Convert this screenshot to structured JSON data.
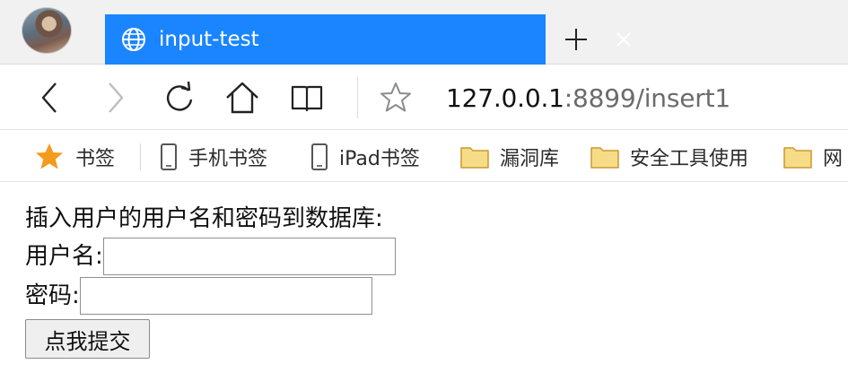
{
  "browser": {
    "tab": {
      "title": "input-test"
    },
    "address": {
      "host": "127.0.0.1",
      "path": ":8899/insert1"
    },
    "bookmarks": [
      {
        "icon": "star-icon",
        "label": "书签"
      },
      {
        "icon": "phone-icon",
        "label": "手机书签"
      },
      {
        "icon": "tablet-icon",
        "label": "iPad书签"
      },
      {
        "icon": "folder-icon",
        "label": "漏洞库"
      },
      {
        "icon": "folder-icon",
        "label": "安全工具使用"
      },
      {
        "icon": "folder-icon",
        "label": "网"
      }
    ],
    "colors": {
      "tab_active": "#1a85ff",
      "bookmark_star": "#f59a1b",
      "folder": "#f3cf6a"
    }
  },
  "page": {
    "heading": "插入用户的用户名和密码到数据库:",
    "username_label": "用户名:",
    "username_value": "",
    "password_label": "密码:",
    "password_value": "",
    "submit_label": "点我提交"
  }
}
